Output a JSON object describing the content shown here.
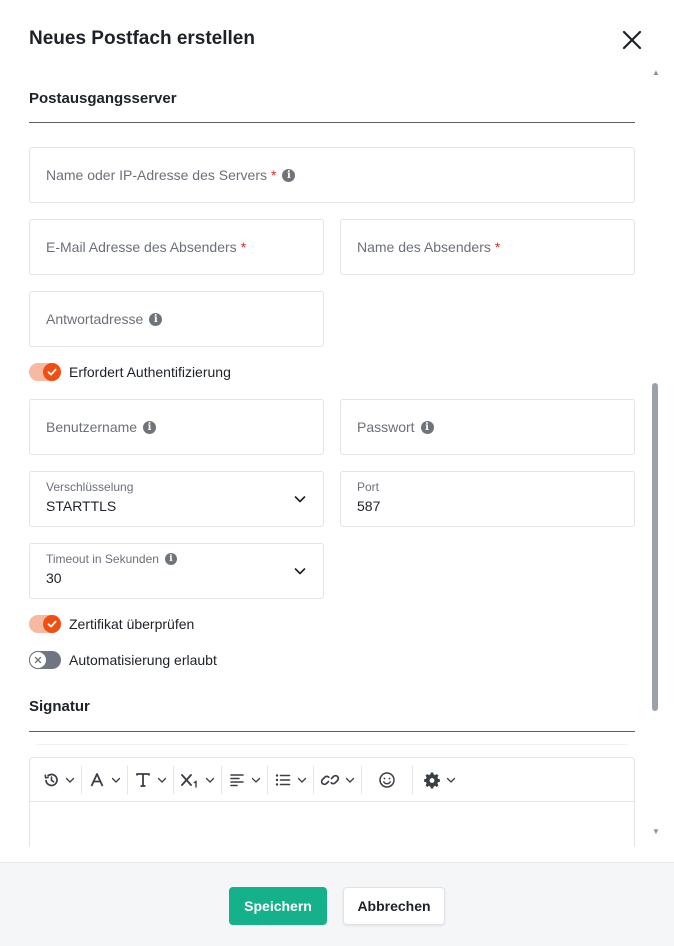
{
  "dialog": {
    "title": "Neues Postfach erstellen"
  },
  "section_outgoing": {
    "title": "Postausgangsserver"
  },
  "fields": {
    "server": {
      "placeholder": "Name oder IP-Adresse des Servers",
      "required": "*"
    },
    "sender_email": {
      "placeholder": "E-Mail Adresse des Absenders",
      "required": "*"
    },
    "sender_name": {
      "placeholder": "Name des Absenders",
      "required": "*"
    },
    "reply_to": {
      "placeholder": "Antwortadresse"
    },
    "username": {
      "placeholder": "Benutzername"
    },
    "password": {
      "placeholder": "Passwort"
    },
    "encryption": {
      "label": "Verschlüsselung",
      "value": "STARTTLS"
    },
    "port": {
      "label": "Port",
      "value": "587"
    },
    "timeout": {
      "label": "Timeout in Sekunden",
      "value": "30"
    }
  },
  "toggles": {
    "auth": {
      "label": "Erfordert Authentifizierung",
      "state": "on"
    },
    "verify_cert": {
      "label": "Zertifikat überprüfen",
      "state": "on"
    },
    "automation": {
      "label": "Automatisierung erlaubt",
      "state": "off"
    }
  },
  "section_signature": {
    "title": "Signatur"
  },
  "editor_toolbar": [
    "history-icon",
    "font-color-icon",
    "text-size-icon",
    "subscript-icon",
    "align-left-icon",
    "bullet-list-icon",
    "link-icon",
    "emoji-icon",
    "settings-gear-icon"
  ],
  "footer": {
    "save_label": "Speichern",
    "cancel_label": "Abbrechen"
  },
  "colors": {
    "accent_toggle": "#f04e13",
    "save_button": "#14b18a",
    "required": "#e02b2b"
  }
}
